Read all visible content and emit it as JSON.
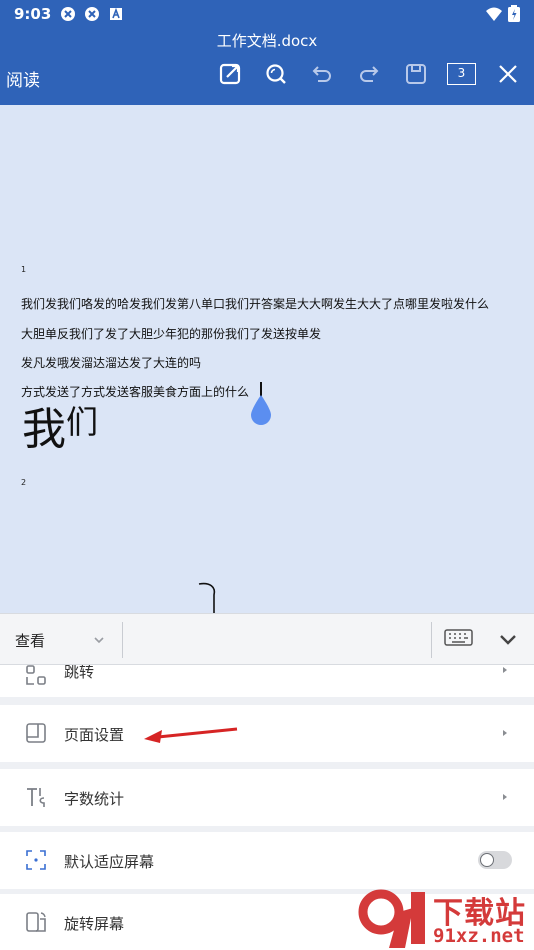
{
  "status_bar": {
    "time": "9:03"
  },
  "header": {
    "title": "工作文档.docx",
    "mode_label": "阅读",
    "page_count": "3"
  },
  "document": {
    "page1_number": "1",
    "lines": [
      "我们发我们咯发的哈发我们发第八单口我们开答案是大大啊发生大大了点哪里发啦发什么",
      "大胆单反我们了发了大胆少年犯的那份我们了发送按单发",
      "发凡发哦发溜达溜达发了大连的吗",
      "方式发送了方式发送客服美食方面上的什么"
    ],
    "big_text_main": "我",
    "big_text_sup": "们",
    "page2_number": "2"
  },
  "toolbar": {
    "view_label": "查看"
  },
  "menu": {
    "items": [
      {
        "label": "跳转",
        "icon": "jump-icon"
      },
      {
        "label": "页面设置",
        "icon": "page-setup-icon"
      },
      {
        "label": "字数统计",
        "icon": "word-count-icon"
      },
      {
        "label": "默认适应屏幕",
        "icon": "fit-screen-icon"
      },
      {
        "label": "旋转屏幕",
        "icon": "rotate-screen-icon"
      }
    ]
  },
  "watermark": {
    "site": "91xz.net",
    "brand": "下载站"
  },
  "colors": {
    "header_bg": "#2f63b8",
    "canvas_bg": "#dbe5f6",
    "cursor_drop": "#5b8ef0",
    "annotation_arrow": "#d62424"
  }
}
